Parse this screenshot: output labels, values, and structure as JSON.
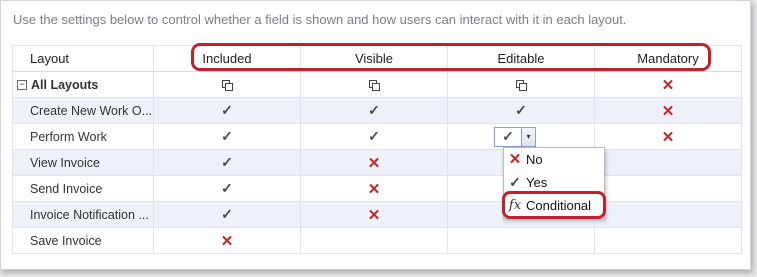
{
  "intro": "Use the settings below to control whether a field is shown and how users can interact with it in each layout.",
  "columns": [
    "Layout",
    "Included",
    "Visible",
    "Editable",
    "Mandatory"
  ],
  "group_row": {
    "collapse_symbol": "−",
    "name": "All Layouts"
  },
  "rows": [
    {
      "name": "Create New Work O...",
      "included": "✓",
      "visible": "✓",
      "editable": "✓",
      "mandatory": "✕"
    },
    {
      "name": "Perform Work",
      "included": "✓",
      "visible": "✓",
      "editable": "✓",
      "mandatory": "✕"
    },
    {
      "name": "View Invoice",
      "included": "✓",
      "visible": "✕",
      "editable": "",
      "mandatory": ""
    },
    {
      "name": "Send Invoice",
      "included": "✓",
      "visible": "✕",
      "editable": "",
      "mandatory": ""
    },
    {
      "name": "Invoice Notification ...",
      "included": "✓",
      "visible": "✕",
      "editable": "",
      "mandatory": ""
    },
    {
      "name": "Save Invoice",
      "included": "✕",
      "visible": "",
      "editable": "",
      "mandatory": ""
    }
  ],
  "editor": {
    "value": "✓",
    "arrow": "▾"
  },
  "dropdown": [
    {
      "icon": "✕",
      "label": "No"
    },
    {
      "icon": "✓",
      "label": "Yes"
    },
    {
      "icon": "fx",
      "label": "Conditional"
    }
  ],
  "colors": {
    "highlight": "#c3202b",
    "cross": "#c0282c",
    "alt_row": "#eef1f8"
  }
}
